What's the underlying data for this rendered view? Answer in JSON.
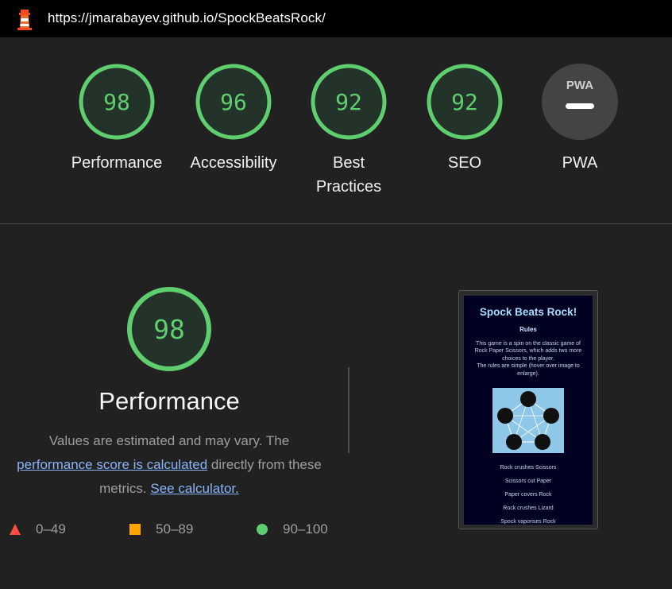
{
  "address_bar": {
    "url": "https://jmarabayev.github.io/SpockBeatsRock/"
  },
  "colors": {
    "pass": "#0cce6b",
    "pass_ring": "#5fce6e",
    "pass_fill": "#24332a",
    "average": "#ffa400",
    "fail": "#ff4e42",
    "pwa_gray": "#444444"
  },
  "categories": [
    {
      "label": "Performance",
      "score": "98"
    },
    {
      "label": "Accessibility",
      "score": "96"
    },
    {
      "label": "Best Practices",
      "score": "92"
    },
    {
      "label": "SEO",
      "score": "92"
    },
    {
      "label": "PWA",
      "badge": "PWA",
      "icon": "pwa-dash-icon"
    }
  ],
  "performance": {
    "score": "98",
    "title": "Performance",
    "desc_prefix": "Values are estimated and may vary. The",
    "link_score": "performance score is calculated",
    "desc_middle": "directly from these metrics.",
    "link_calculator": "See calculator."
  },
  "legend": [
    {
      "range": "0–49",
      "icon": "triangle-fail-icon"
    },
    {
      "range": "50–89",
      "icon": "square-average-icon"
    },
    {
      "range": "90–100",
      "icon": "circle-pass-icon"
    }
  ],
  "screenshot": {
    "title": "Spock Beats Rock!",
    "rules_heading": "Rules",
    "para1": "This game is a spin on the classic game of Rock Paper Scissors, which adds two more choices to the player.",
    "para2": "The rules are simple (hover over image to enlarge).",
    "rules": [
      "Rock crushes Scissors",
      "Scissors cut Paper",
      "Paper covers Rock",
      "Rock crushes Lizard",
      "Spock vaporises Rock"
    ]
  }
}
